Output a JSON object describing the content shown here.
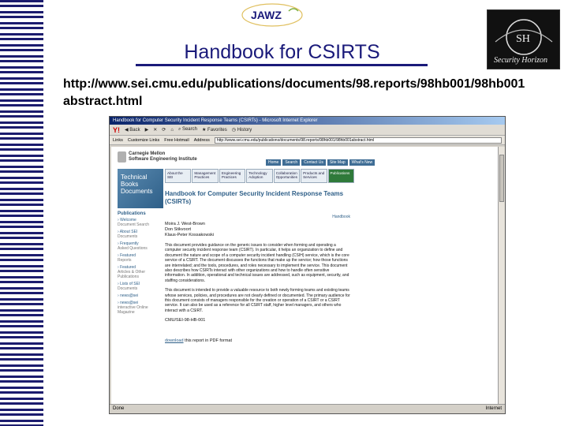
{
  "slide": {
    "title": "Handbook for CSIRTS",
    "url_line1": "http://www.sei.cmu.edu/publications/documents/98.reports/98hb001/98hb001",
    "url_line2": "abstract.html"
  },
  "logos": {
    "top": "JAWZ",
    "right_initials": "SH",
    "right_name": "Security Horizon"
  },
  "colors": {
    "title_blue": "#1a1a7a",
    "stripe_navy": "#1c1c6e",
    "link_blue": "#2e5f88",
    "publications_green": "#2f7a3a"
  },
  "browser": {
    "window_title": "Handbook for Computer Security Incident Response Teams (CSIRTs) - Microsoft Internet Explorer",
    "toolbar": {
      "yahoo": "Y!",
      "back": "Back",
      "search": "Search",
      "favorites": "Favorites",
      "history": "History"
    },
    "links_bar": {
      "links": "Links",
      "customize": "Customize Links",
      "free_hotmail": "Free Hotmail",
      "address_label": "Address",
      "address_value": "http://www.sei.cmu.edu/publications/documents/98.reports/98hb001/98hb001abstract.html"
    },
    "status": {
      "left": "Done",
      "right": "Internet"
    }
  },
  "webpage": {
    "org_line1": "Carnegie Mellon",
    "org_line2": "Software Engineering Institute",
    "topnav": [
      "Home",
      "Search",
      "Contact Us",
      "Site Map",
      "What's New"
    ],
    "banner": "Technical Books Documents",
    "mainnav": [
      "About the SEI",
      "Management Practices",
      "Engineering Practices",
      "Technology Adoption",
      "Collaboration Opportunities",
      "Products and Services",
      "Publications"
    ],
    "sidebar_title": "Publications",
    "sidebar": [
      {
        "label": "Welcome",
        "sub": "Document Search"
      },
      {
        "label": "About SEI",
        "sub": "Documents"
      },
      {
        "label": "Frequently",
        "sub": "Asked Questions"
      },
      {
        "label": "Featured",
        "sub": "Reports"
      },
      {
        "label": "Featured",
        "sub": "Articles & Other Publications"
      },
      {
        "label": "Lists of SEI",
        "sub": "Documents"
      },
      {
        "label": "news@sei",
        "sub": ""
      },
      {
        "label": "news@sei",
        "sub": "interactive Online Magazine"
      }
    ],
    "doc_title": "Handbook for Computer Security Incident Response Teams (CSIRTs)",
    "handbook_link": "Handbook",
    "authors": [
      "Moira J. West-Brown",
      "Don Stikvoort",
      "Klaus-Peter Kossakowski"
    ],
    "para1": "This document provides guidance on the generic issues to consider when forming and operating a computer security incident response team (CSIRT). In particular, it helps an organization to define and document the nature and scope of a computer security incident handling (CSIH) service, which is the core service of a CSIRT. The document discusses the functions that make up the service; how those functions are interrelated; and the tools, procedures, and roles necessary to implement the service. This document also describes how CSIRTs interact with other organizations and how to handle often sensitive information. In addition, operational and technical issues are addressed, such as equipment, security, and staffing considerations.",
    "para2": "This document is intended to provide a valuable resource to both newly forming teams and existing teams whose services, policies, and procedures are not clearly defined or documented. The primary audience for this document consists of managers responsible for the creation or operation of a CSIRT or a CSIRT service. It can also be used as a reference for all CSIRT staff, higher level managers, and others who interact with a CSIRT.",
    "doc_id": "CMU/SEI-98-HB-001",
    "download_link": "download",
    "download_rest": "this report in PDF format"
  }
}
